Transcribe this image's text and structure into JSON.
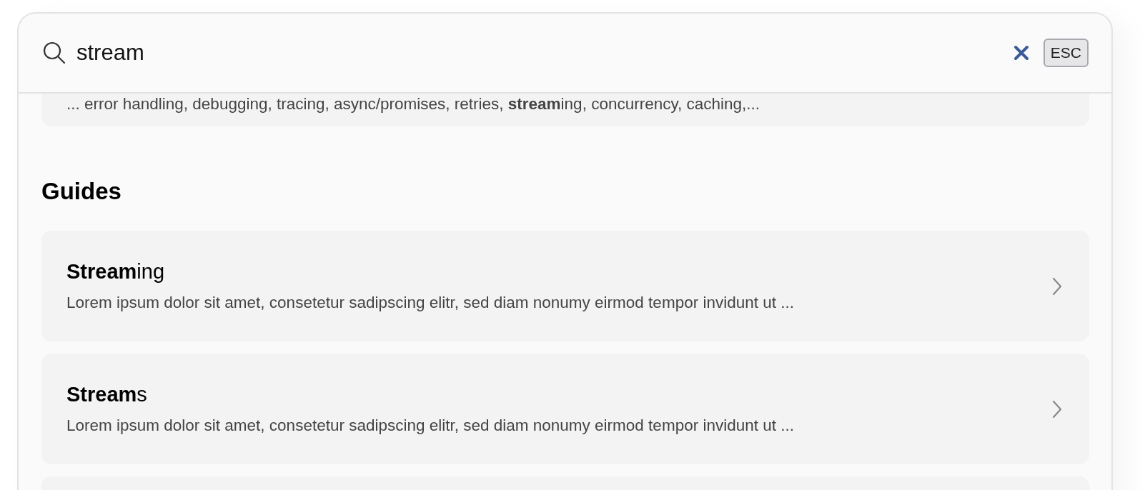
{
  "search": {
    "value": "stream"
  },
  "esc_key": {
    "label": "ESC"
  },
  "top_result": {
    "excerpt": "... error handling, debugging, tracing, async/promises, retries, **stream**ing, concurrency, caching,..."
  },
  "sections": [
    {
      "heading": "Guides",
      "results": [
        {
          "title": "**Stream**ing",
          "excerpt": "Lorem ipsum dolor sit amet, consetetur sadipscing elitr, sed diam nonumy eirmod tempor invidunt ut ..."
        },
        {
          "title": "**Stream**s",
          "excerpt": "Lorem ipsum dolor sit amet, consetetur sadipscing elitr, sed diam nonumy eirmod tempor invidunt ut ..."
        }
      ]
    }
  ]
}
